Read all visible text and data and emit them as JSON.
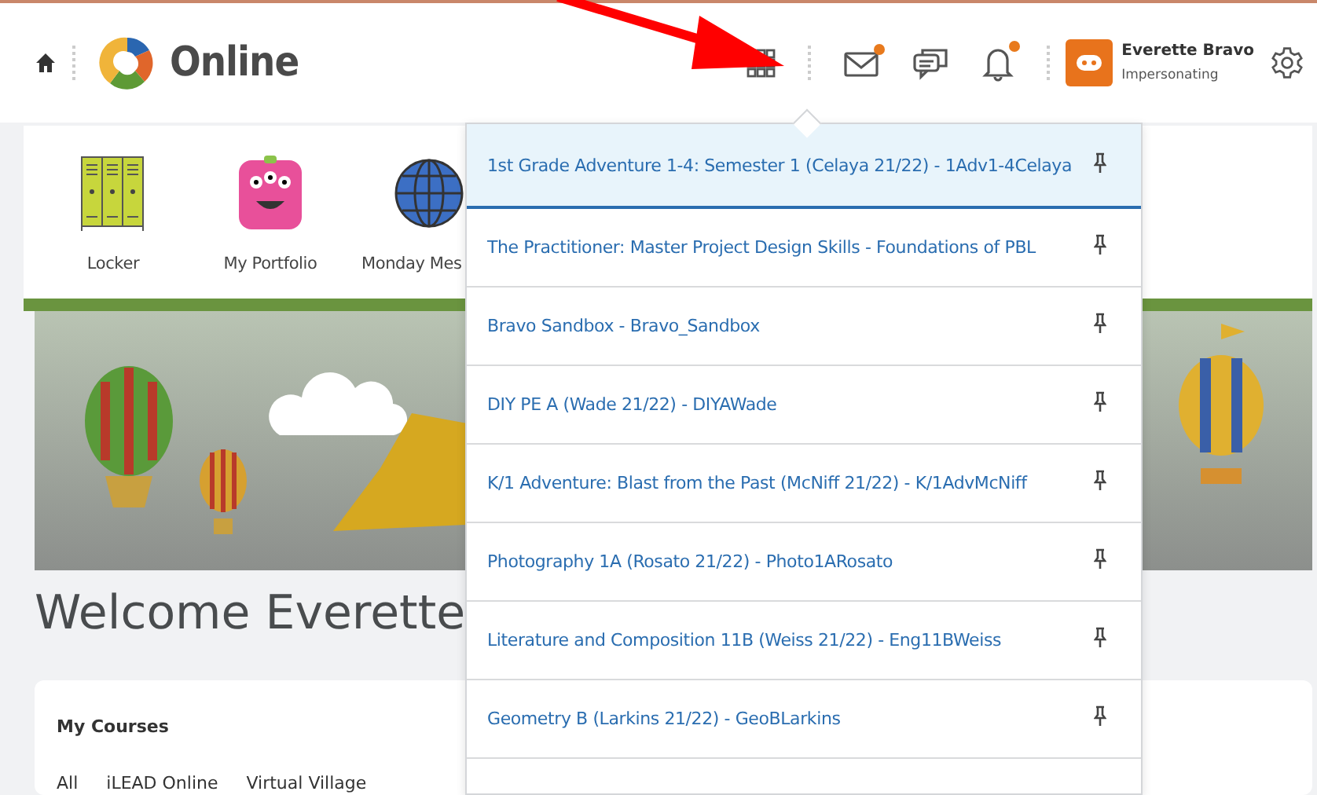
{
  "header": {
    "logo_text": "Online",
    "icons": [
      {
        "kind": "grid",
        "unread": false
      },
      {
        "kind": "mail",
        "unread": true
      },
      {
        "kind": "chat",
        "unread": false
      },
      {
        "kind": "bell",
        "unread": true
      }
    ],
    "user": {
      "name": "Everette Bravo",
      "role": "Impersonating"
    }
  },
  "quick_links": [
    {
      "label": "Locker",
      "kind": "locker"
    },
    {
      "label": "My Portfolio",
      "kind": "monster"
    },
    {
      "label": "Monday Mes",
      "kind": "globe"
    }
  ],
  "welcome": "Welcome Everette",
  "my_courses": {
    "title": "My Courses",
    "tabs": [
      "All",
      "iLEAD Online",
      "Virtual Village"
    ]
  },
  "course_menu": {
    "items": [
      {
        "label": "1st Grade Adventure 1-4: Semester 1 (Celaya 21/22) - 1Adv1-4Celaya",
        "selected": true
      },
      {
        "label": "The Practitioner: Master Project Design Skills - Foundations of PBL",
        "selected": false
      },
      {
        "label": "Bravo Sandbox - Bravo_Sandbox",
        "selected": false
      },
      {
        "label": "DIY PE A (Wade 21/22) - DIYAWade",
        "selected": false
      },
      {
        "label": "K/1 Adventure: Blast from the Past (McNiff 21/22) - K/1AdvMcNiff",
        "selected": false
      },
      {
        "label": "Photography 1A (Rosato 21/22) - Photo1ARosato",
        "selected": false
      },
      {
        "label": "Literature and Composition 11B (Weiss 21/22) - Eng11BWeiss",
        "selected": false
      },
      {
        "label": "Geometry B (Larkins 21/22) - GeoBLarkins",
        "selected": false
      }
    ]
  }
}
